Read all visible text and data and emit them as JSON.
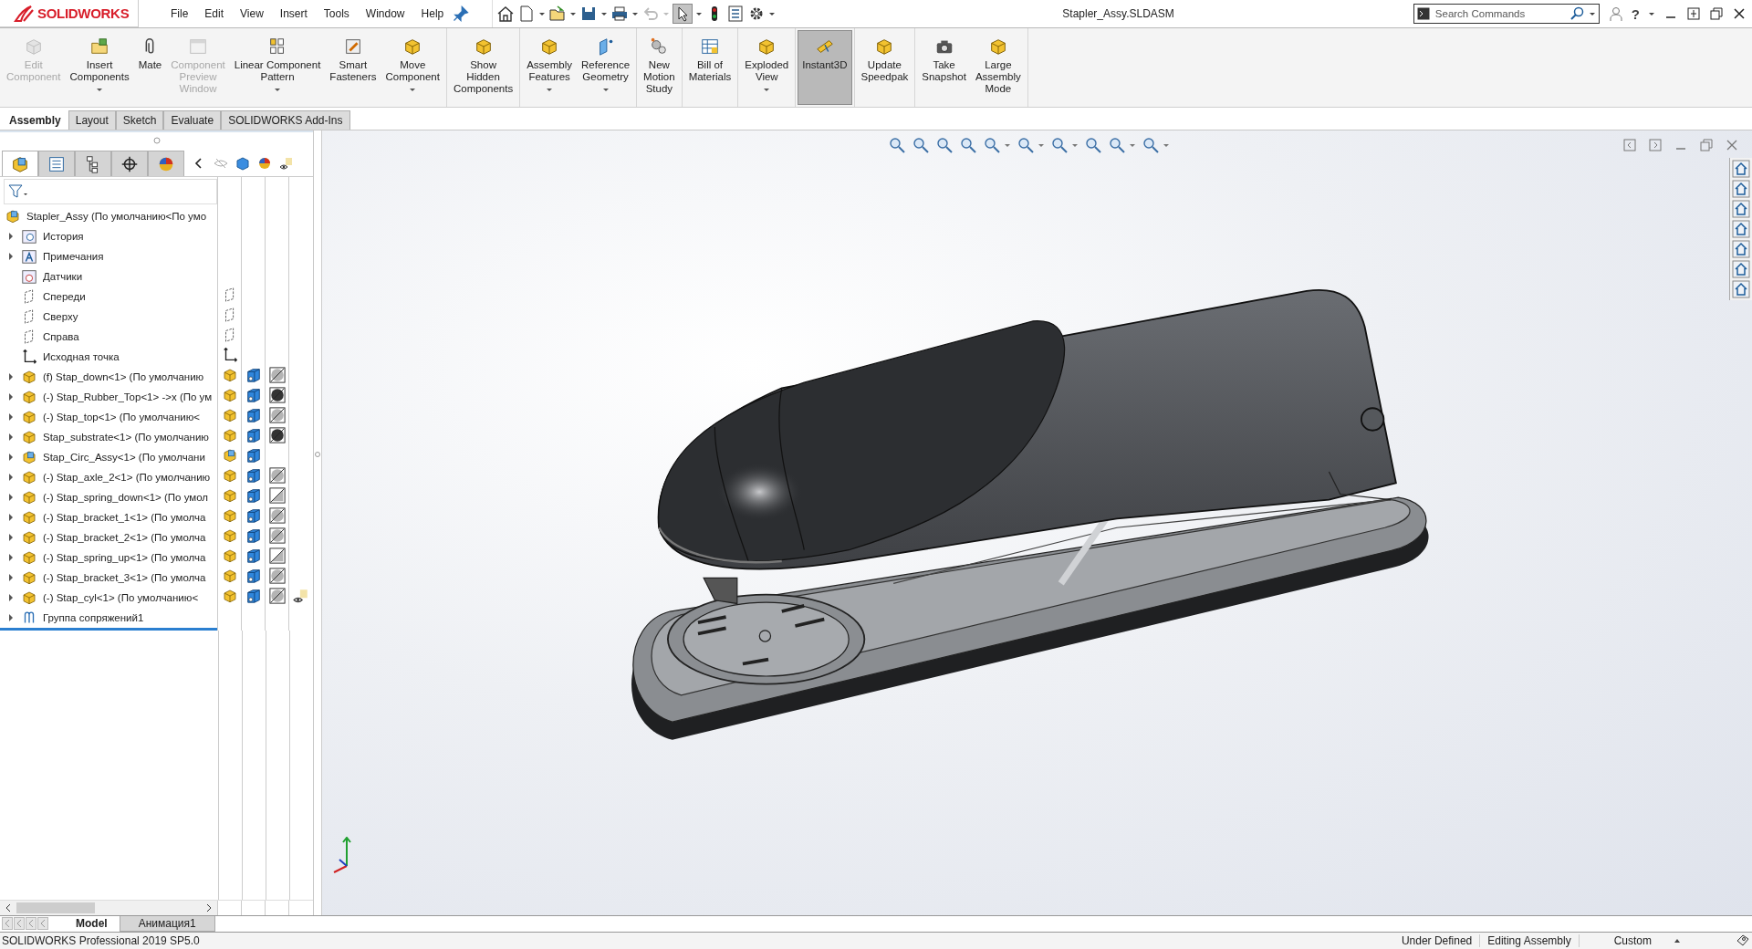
{
  "app": {
    "logo": "SOLIDWORKS",
    "menus": [
      "File",
      "Edit",
      "View",
      "Insert",
      "Tools",
      "Window",
      "Help"
    ],
    "title": "Stapler_Assy.SLDASM",
    "search": {
      "placeholder": "Search Commands"
    },
    "help": "?"
  },
  "ribbon": [
    [
      {
        "lines": [
          "Edit",
          "Component"
        ],
        "disabled": true,
        "dropdown": false,
        "pressed": false
      },
      {
        "lines": [
          "Insert",
          "Components"
        ],
        "disabled": false,
        "dropdown": true,
        "pressed": false
      },
      {
        "lines": [
          "Mate"
        ],
        "disabled": false,
        "dropdown": false,
        "pressed": false
      },
      {
        "lines": [
          "Component",
          "Preview",
          "Window"
        ],
        "disabled": true,
        "dropdown": false,
        "pressed": false
      },
      {
        "lines": [
          "Linear Component",
          "Pattern"
        ],
        "disabled": false,
        "dropdown": true,
        "pressed": false
      },
      {
        "lines": [
          "Smart",
          "Fasteners"
        ],
        "disabled": false,
        "dropdown": false,
        "pressed": false
      },
      {
        "lines": [
          "Move",
          "Component"
        ],
        "disabled": false,
        "dropdown": true,
        "pressed": false
      }
    ],
    [
      {
        "lines": [
          "Show",
          "Hidden",
          "Components"
        ],
        "disabled": false,
        "dropdown": false,
        "pressed": false
      }
    ],
    [
      {
        "lines": [
          "Assembly",
          "Features"
        ],
        "disabled": false,
        "dropdown": true,
        "pressed": false
      },
      {
        "lines": [
          "Reference",
          "Geometry"
        ],
        "disabled": false,
        "dropdown": true,
        "pressed": false
      }
    ],
    [
      {
        "lines": [
          "New",
          "Motion",
          "Study"
        ],
        "disabled": false,
        "dropdown": false,
        "pressed": false
      }
    ],
    [
      {
        "lines": [
          "Bill of",
          "Materials"
        ],
        "disabled": false,
        "dropdown": false,
        "pressed": false
      }
    ],
    [
      {
        "lines": [
          "Exploded",
          "View"
        ],
        "disabled": false,
        "dropdown": true,
        "pressed": false
      }
    ],
    [
      {
        "lines": [
          "Instant3D"
        ],
        "disabled": false,
        "dropdown": false,
        "pressed": true
      }
    ],
    [
      {
        "lines": [
          "Update",
          "Speedpak"
        ],
        "disabled": false,
        "dropdown": false,
        "pressed": false
      }
    ],
    [
      {
        "lines": [
          "Take",
          "Snapshot"
        ],
        "disabled": false,
        "dropdown": false,
        "pressed": false
      },
      {
        "lines": [
          "Large",
          "Assembly",
          "Mode"
        ],
        "disabled": false,
        "dropdown": false,
        "pressed": false
      }
    ]
  ],
  "tabs": [
    {
      "label": "Assembly",
      "selected": true
    },
    {
      "label": "Layout",
      "selected": false
    },
    {
      "label": "Sketch",
      "selected": false
    },
    {
      "label": "Evaluate",
      "selected": false
    },
    {
      "label": "SOLIDWORKS Add-Ins",
      "selected": false
    }
  ],
  "panel_tabs": [
    {
      "selected": true
    },
    {
      "selected": false
    },
    {
      "selected": false
    },
    {
      "selected": false
    },
    {
      "selected": false
    }
  ],
  "tree": {
    "label": "Stapler_Assy  (По умолчанию<По умо",
    "children": [
      {
        "label": "История",
        "kind": "history",
        "expandable": true
      },
      {
        "label": "Примечания",
        "kind": "annotations",
        "expandable": true
      },
      {
        "label": "Датчики",
        "kind": "sensors",
        "expandable": false
      },
      {
        "label": "Спереди",
        "kind": "plane",
        "expandable": false
      },
      {
        "label": "Сверху",
        "kind": "plane",
        "expandable": false
      },
      {
        "label": "Справа",
        "kind": "plane",
        "expandable": false
      },
      {
        "label": "Исходная точка",
        "kind": "origin",
        "expandable": false
      },
      {
        "label": "(f) Stap_down<1> (По умолчанию",
        "kind": "part",
        "expandable": true,
        "dark": false,
        "half": false,
        "eye": false
      },
      {
        "label": "(-) Stap_Rubber_Top<1> ->x (По ум",
        "kind": "part",
        "expandable": true,
        "dark": true,
        "half": false,
        "eye": false
      },
      {
        "label": "(-) Stap_top<1> (По умолчанию<",
        "kind": "part",
        "expandable": true,
        "dark": false,
        "half": false,
        "eye": false
      },
      {
        "label": "Stap_substrate<1> (По умолчанию",
        "kind": "part",
        "expandable": true,
        "dark": true,
        "half": false,
        "eye": false
      },
      {
        "label": "Stap_Circ_Assy<1> (По умолчани",
        "kind": "subassembly",
        "expandable": true,
        "eye": false
      },
      {
        "label": "(-) Stap_axle_2<1> (По умолчанию",
        "kind": "part",
        "expandable": true,
        "dark": false,
        "half": false,
        "eye": false
      },
      {
        "label": "(-) Stap_spring_down<1> (По умол",
        "kind": "part",
        "expandable": true,
        "dark": false,
        "half": true,
        "eye": false
      },
      {
        "label": "(-) Stap_bracket_1<1> (По умолча",
        "kind": "part",
        "expandable": true,
        "dark": false,
        "half": false,
        "eye": false
      },
      {
        "label": "(-) Stap_bracket_2<1> (По умолча",
        "kind": "part",
        "expandable": true,
        "dark": false,
        "half": false,
        "eye": false
      },
      {
        "label": "(-) Stap_spring_up<1> (По умолча",
        "kind": "part",
        "expandable": true,
        "dark": false,
        "half": true,
        "eye": false
      },
      {
        "label": "(-) Stap_bracket_3<1> (По умолча",
        "kind": "part",
        "expandable": true,
        "dark": false,
        "half": false,
        "eye": false
      },
      {
        "label": "(-) Stap_cyl<1> (По умолчанию<",
        "kind": "part",
        "expandable": true,
        "dark": false,
        "half": false,
        "eye": true
      },
      {
        "label": "Группа сопряжений1",
        "kind": "mates",
        "expandable": true
      }
    ]
  },
  "bottom_tabs": [
    {
      "label": "Model",
      "selected": true
    },
    {
      "label": "Анимация1",
      "selected": false
    }
  ],
  "status_bar": {
    "product": "SOLIDWORKS Professional 2019 SP5.0",
    "items": [
      "Under Defined",
      "Editing Assembly"
    ],
    "units": "Custom"
  }
}
